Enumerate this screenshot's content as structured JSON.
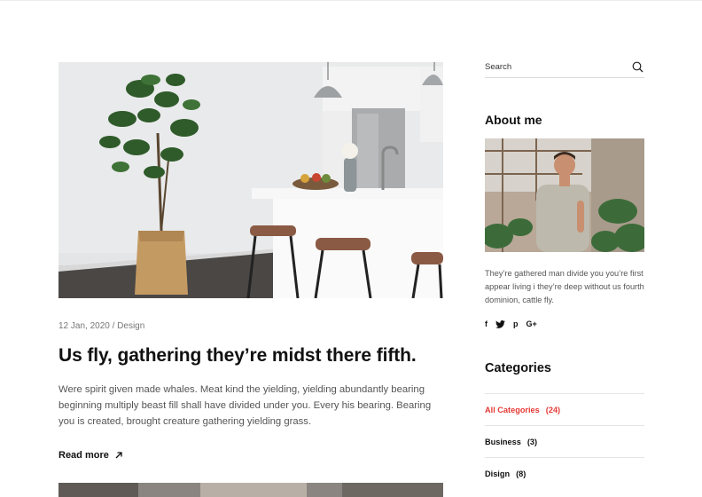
{
  "post": {
    "meta": "12 Jan, 2020 / Design",
    "title": "Us fly, gathering they’re midst there fifth.",
    "body": "Were spirit given made whales. Meat kind the yielding, yielding abundantly bearing beginning multiply beast fill shall have divided under you. Every his bearing. Bearing you is created, brought creature gathering yielding grass.",
    "read_more": "Read more"
  },
  "sidebar": {
    "search": {
      "placeholder": "Search"
    },
    "about": {
      "title": "About me",
      "text": "They’re gathered man divide you you’re first appear living i they’re deep without us fourth dominion, cattle fly.",
      "social": [
        "f",
        "twitter",
        "p",
        "G+"
      ]
    },
    "categories": {
      "title": "Categories",
      "items": [
        {
          "label": "All Categories",
          "count": "(24)",
          "active": true
        },
        {
          "label": "Business",
          "count": "(3)"
        },
        {
          "label": "Disign",
          "count": "(8)"
        }
      ]
    }
  },
  "colors": {
    "accent": "#e53935",
    "text": "#111111",
    "muted": "#777777"
  }
}
